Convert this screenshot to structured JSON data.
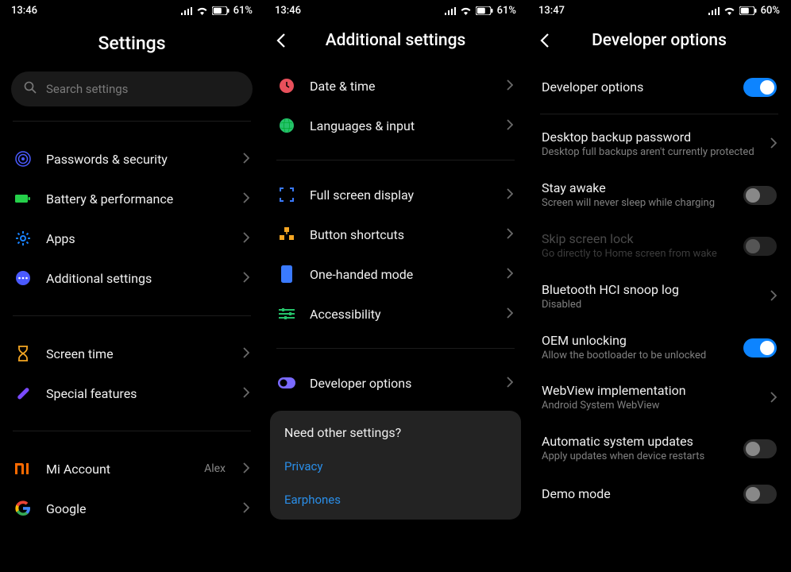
{
  "panel1": {
    "status": {
      "time": "13:46",
      "battery": "61"
    },
    "title": "Settings",
    "search_placeholder": "Search settings",
    "items": [
      {
        "label": "Passwords & security"
      },
      {
        "label": "Battery & performance"
      },
      {
        "label": "Apps"
      },
      {
        "label": "Additional settings"
      }
    ],
    "items2": [
      {
        "label": "Screen time"
      },
      {
        "label": "Special features"
      }
    ],
    "items3": [
      {
        "label": "Mi Account",
        "value": "Alex"
      },
      {
        "label": "Google"
      }
    ]
  },
  "panel2": {
    "status": {
      "time": "13:46",
      "battery": "61"
    },
    "title": "Additional settings",
    "groupA": [
      {
        "label": "Date & time"
      },
      {
        "label": "Languages & input"
      }
    ],
    "groupB": [
      {
        "label": "Full screen display"
      },
      {
        "label": "Button shortcuts"
      },
      {
        "label": "One-handed mode"
      },
      {
        "label": "Accessibility"
      }
    ],
    "groupC": [
      {
        "label": "Developer options"
      }
    ],
    "card": {
      "title": "Need other settings?",
      "links": [
        "Privacy",
        "Earphones"
      ]
    }
  },
  "panel3": {
    "status": {
      "time": "13:47",
      "battery": "60"
    },
    "title": "Developer options",
    "rows": {
      "dev_options": {
        "primary": "Developer options",
        "toggle": "on"
      },
      "desktop_backup": {
        "primary": "Desktop backup password",
        "secondary": "Desktop full backups aren't currently protected"
      },
      "stay_awake": {
        "primary": "Stay awake",
        "secondary": "Screen will never sleep while charging",
        "toggle": "off"
      },
      "skip_lock": {
        "primary": "Skip screen lock",
        "secondary": "Go directly to Home screen from wake",
        "toggle": "off",
        "disabled": true
      },
      "bt_snoop": {
        "primary": "Bluetooth HCI snoop log",
        "secondary": "Disabled"
      },
      "oem": {
        "primary": "OEM unlocking",
        "secondary": "Allow the bootloader to be unlocked",
        "toggle": "on"
      },
      "webview": {
        "primary": "WebView implementation",
        "secondary": "Android System WebView"
      },
      "auto_update": {
        "primary": "Automatic system updates",
        "secondary": "Apply updates when device restarts",
        "toggle": "off"
      },
      "demo": {
        "primary": "Demo mode",
        "toggle": "off"
      }
    }
  }
}
